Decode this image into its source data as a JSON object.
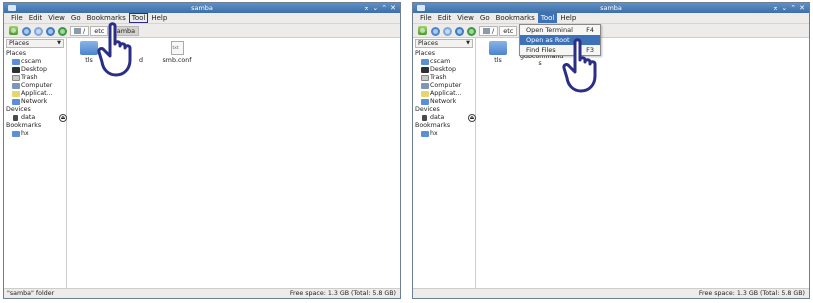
{
  "window_title": "samba",
  "title_controls": [
    "⌅",
    "⌄",
    "⌃",
    "✕"
  ],
  "menubar": [
    "File",
    "Edit",
    "View",
    "Go",
    "Bookmarks",
    "Tool",
    "Help"
  ],
  "path": {
    "root_label": "/",
    "segments": [
      "etc",
      "samba"
    ]
  },
  "sidebar": {
    "combo_label": "Places",
    "places_heading": "Places",
    "places": [
      "cscam",
      "Desktop",
      "Trash",
      "Computer",
      "Applicat...",
      "Network"
    ],
    "devices_heading": "Devices",
    "devices": [
      "data"
    ],
    "bookmarks_heading": "Bookmarks",
    "bookmarks": [
      "hx"
    ]
  },
  "left": {
    "files": [
      "tls",
      "smb.conf"
    ],
    "partial_file_label": "d",
    "status_left": "\"samba\" folder",
    "status_right": "Free space: 1.3 GB (Total: 5.8 GB)"
  },
  "right": {
    "files": [
      "tls",
      "gdbcommand s"
    ],
    "status_left": "",
    "status_right": "Free space: 1.3 GB (Total: 5.8 GB)",
    "tool_menu": [
      {
        "label": "Open Terminal",
        "shortcut": "F4"
      },
      {
        "label": "Open as Root",
        "shortcut": ""
      },
      {
        "label": "Find Files",
        "shortcut": "F3"
      }
    ]
  },
  "colors": {
    "highlight": "#3d72b9",
    "focus_box": "#2b2e86",
    "hand_outline": "#2b2e86"
  }
}
